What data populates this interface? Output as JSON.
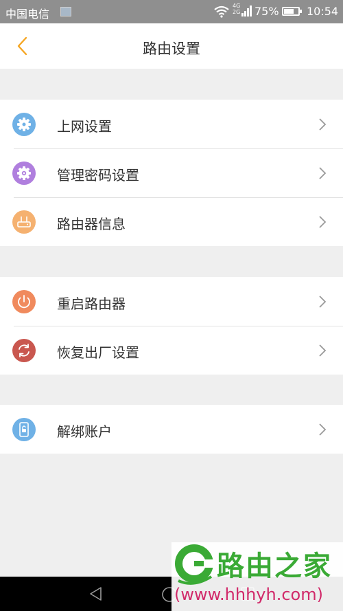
{
  "status_bar": {
    "carrier": "中国电信",
    "net_type_top": "4G",
    "net_type_bottom": "2G",
    "battery_percent": "75%",
    "battery_level": 0.75,
    "time": "10:54"
  },
  "header": {
    "title": "路由设置",
    "back_icon": "chevron-left-icon",
    "accent_color": "#f5a623"
  },
  "groups": [
    {
      "items": [
        {
          "label": "上网设置",
          "icon": "gear-icon",
          "icon_color": "#6fb1e6"
        },
        {
          "label": "管理密码设置",
          "icon": "gear-shield-icon",
          "icon_color": "#b07fde"
        },
        {
          "label": "路由器信息",
          "icon": "router-icon",
          "icon_color": "#f5b170"
        }
      ]
    },
    {
      "items": [
        {
          "label": "重启路由器",
          "icon": "power-icon",
          "icon_color": "#f08a5d"
        },
        {
          "label": "恢复出厂设置",
          "icon": "restore-icon",
          "icon_color": "#c9574f"
        }
      ]
    },
    {
      "items": [
        {
          "label": "解绑账户",
          "icon": "unbind-phone-icon",
          "icon_color": "#6fb1e6"
        }
      ]
    }
  ],
  "navbar": {
    "back_icon": "nav-back-icon",
    "home_icon": "nav-home-icon",
    "recent_icon": "nav-recent-icon"
  },
  "watermark": {
    "brand": "路由之家",
    "url": "(www.hhhyh.com)",
    "brand_color": "#3aaa35",
    "url_color": "#d12a6a"
  }
}
